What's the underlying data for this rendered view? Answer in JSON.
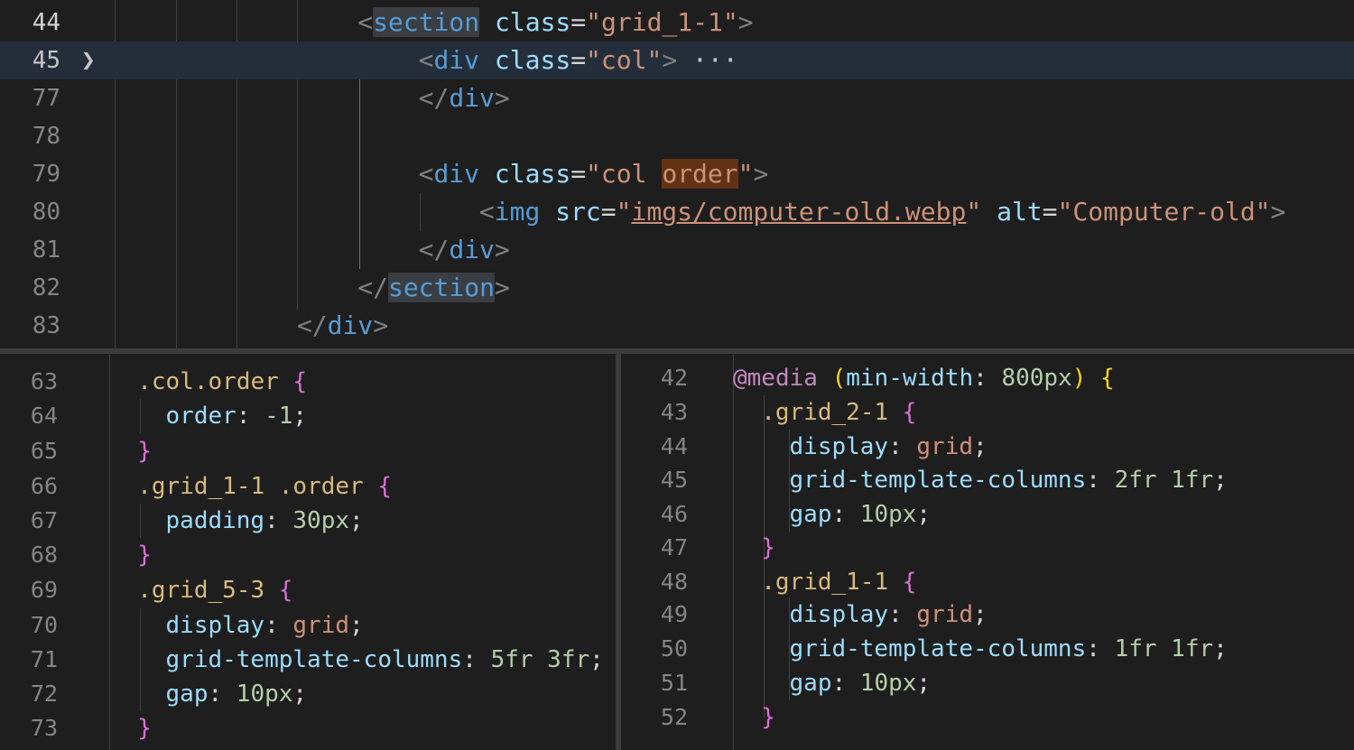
{
  "top_editor": {
    "lines": [
      {
        "n": "44",
        "parts": [
          {
            "t": "<",
            "c": "p"
          },
          {
            "t": "section",
            "c": "t sect"
          },
          {
            "t": " ",
            "c": "o"
          },
          {
            "t": "class",
            "c": "a"
          },
          {
            "t": "=",
            "c": "o"
          },
          {
            "t": "\"grid_1-1\"",
            "c": "s"
          },
          {
            "t": ">",
            "c": "p"
          }
        ]
      },
      {
        "n": "45",
        "parts": [
          {
            "t": "<",
            "c": "p"
          },
          {
            "t": "div",
            "c": "t"
          },
          {
            "t": " ",
            "c": "o"
          },
          {
            "t": "class",
            "c": "a"
          },
          {
            "t": "=",
            "c": "o"
          },
          {
            "t": "\"col\"",
            "c": "s"
          },
          {
            "t": ">",
            "c": "p"
          },
          {
            "t": " ···",
            "c": "ell"
          }
        ]
      },
      {
        "n": "77",
        "parts": [
          {
            "t": "</",
            "c": "p"
          },
          {
            "t": "div",
            "c": "t"
          },
          {
            "t": ">",
            "c": "p"
          }
        ]
      },
      {
        "n": "78",
        "parts": []
      },
      {
        "n": "79",
        "parts": [
          {
            "t": "<",
            "c": "p"
          },
          {
            "t": "div",
            "c": "t"
          },
          {
            "t": " ",
            "c": "o"
          },
          {
            "t": "class",
            "c": "a"
          },
          {
            "t": "=",
            "c": "o"
          },
          {
            "t": "\"col ",
            "c": "s"
          },
          {
            "t": "order",
            "c": "s hl"
          },
          {
            "t": "\"",
            "c": "s"
          },
          {
            "t": ">",
            "c": "p"
          }
        ]
      },
      {
        "n": "80",
        "parts": [
          {
            "t": "<",
            "c": "p"
          },
          {
            "t": "img",
            "c": "t"
          },
          {
            "t": " ",
            "c": "o"
          },
          {
            "t": "src",
            "c": "a"
          },
          {
            "t": "=",
            "c": "o"
          },
          {
            "t": "\"",
            "c": "s"
          },
          {
            "t": "imgs/computer-old.webp",
            "c": "s ul"
          },
          {
            "t": "\"",
            "c": "s"
          },
          {
            "t": " ",
            "c": "o"
          },
          {
            "t": "alt",
            "c": "a"
          },
          {
            "t": "=",
            "c": "o"
          },
          {
            "t": "\"Computer-old\"",
            "c": "s"
          },
          {
            "t": ">",
            "c": "p"
          }
        ]
      },
      {
        "n": "81",
        "parts": [
          {
            "t": "</",
            "c": "p"
          },
          {
            "t": "div",
            "c": "t"
          },
          {
            "t": ">",
            "c": "p"
          }
        ]
      },
      {
        "n": "82",
        "parts": [
          {
            "t": "</",
            "c": "p"
          },
          {
            "t": "section",
            "c": "t sect"
          },
          {
            "t": ">",
            "c": "p"
          }
        ]
      },
      {
        "n": "83",
        "parts": [
          {
            "t": "</",
            "c": "p"
          },
          {
            "t": "div",
            "c": "t"
          },
          {
            "t": ">",
            "c": "p"
          }
        ]
      }
    ]
  },
  "left_editor": {
    "lines": [
      {
        "n": "63",
        "parts": [
          {
            "t": ".col.order",
            "c": "sel"
          },
          {
            "t": " ",
            "c": "o"
          },
          {
            "t": "{",
            "c": "b1"
          }
        ]
      },
      {
        "n": "64",
        "parts": [
          {
            "t": "order",
            "c": "a"
          },
          {
            "t": ": ",
            "c": "o"
          },
          {
            "t": "-1",
            "c": "num2"
          },
          {
            "t": ";",
            "c": "o"
          }
        ]
      },
      {
        "n": "65",
        "parts": [
          {
            "t": "}",
            "c": "b1"
          }
        ]
      },
      {
        "n": "66",
        "parts": [
          {
            "t": ".grid_1-1 .order",
            "c": "sel"
          },
          {
            "t": " ",
            "c": "o"
          },
          {
            "t": "{",
            "c": "b1"
          }
        ]
      },
      {
        "n": "67",
        "parts": [
          {
            "t": "padding",
            "c": "a"
          },
          {
            "t": ": ",
            "c": "o"
          },
          {
            "t": "30px",
            "c": "num2"
          },
          {
            "t": ";",
            "c": "o"
          }
        ]
      },
      {
        "n": "68",
        "parts": [
          {
            "t": "}",
            "c": "b1"
          }
        ]
      },
      {
        "n": "69",
        "parts": [
          {
            "t": ".grid_5-3",
            "c": "sel"
          },
          {
            "t": " ",
            "c": "o"
          },
          {
            "t": "{",
            "c": "b1"
          }
        ]
      },
      {
        "n": "70",
        "parts": [
          {
            "t": "display",
            "c": "a"
          },
          {
            "t": ": ",
            "c": "o"
          },
          {
            "t": "grid",
            "c": "s"
          },
          {
            "t": ";",
            "c": "o"
          }
        ]
      },
      {
        "n": "71",
        "parts": [
          {
            "t": "grid-template-columns",
            "c": "a"
          },
          {
            "t": ": ",
            "c": "o"
          },
          {
            "t": "5fr 3fr",
            "c": "num2"
          },
          {
            "t": ";",
            "c": "o"
          }
        ]
      },
      {
        "n": "72",
        "parts": [
          {
            "t": "gap",
            "c": "a"
          },
          {
            "t": ": ",
            "c": "o"
          },
          {
            "t": "10px",
            "c": "num2"
          },
          {
            "t": ";",
            "c": "o"
          }
        ]
      },
      {
        "n": "73",
        "parts": [
          {
            "t": "}",
            "c": "b1"
          }
        ]
      }
    ]
  },
  "right_editor": {
    "lines": [
      {
        "n": "42",
        "parts": [
          {
            "t": "@media",
            "c": "kw"
          },
          {
            "t": " ",
            "c": "o"
          },
          {
            "t": "(",
            "c": "b2"
          },
          {
            "t": "min-width",
            "c": "a"
          },
          {
            "t": ": ",
            "c": "o"
          },
          {
            "t": "800px",
            "c": "num2"
          },
          {
            "t": ")",
            "c": "b2"
          },
          {
            "t": " ",
            "c": "o"
          },
          {
            "t": "{",
            "c": "b2"
          }
        ]
      },
      {
        "n": "43",
        "parts": [
          {
            "t": ".grid_2-1",
            "c": "sel"
          },
          {
            "t": " ",
            "c": "o"
          },
          {
            "t": "{",
            "c": "b1"
          }
        ]
      },
      {
        "n": "44",
        "parts": [
          {
            "t": "display",
            "c": "a"
          },
          {
            "t": ": ",
            "c": "o"
          },
          {
            "t": "grid",
            "c": "s"
          },
          {
            "t": ";",
            "c": "o"
          }
        ]
      },
      {
        "n": "45",
        "parts": [
          {
            "t": "grid-template-columns",
            "c": "a"
          },
          {
            "t": ": ",
            "c": "o"
          },
          {
            "t": "2fr 1fr",
            "c": "num2"
          },
          {
            "t": ";",
            "c": "o"
          }
        ]
      },
      {
        "n": "46",
        "parts": [
          {
            "t": "gap",
            "c": "a"
          },
          {
            "t": ": ",
            "c": "o"
          },
          {
            "t": "10px",
            "c": "num2"
          },
          {
            "t": ";",
            "c": "o"
          }
        ]
      },
      {
        "n": "47",
        "parts": [
          {
            "t": "}",
            "c": "b1"
          }
        ]
      },
      {
        "n": "48",
        "parts": [
          {
            "t": ".grid_1-1",
            "c": "sel"
          },
          {
            "t": " ",
            "c": "o"
          },
          {
            "t": "{",
            "c": "b1"
          }
        ]
      },
      {
        "n": "49",
        "parts": [
          {
            "t": "display",
            "c": "a"
          },
          {
            "t": ": ",
            "c": "o"
          },
          {
            "t": "grid",
            "c": "s"
          },
          {
            "t": ";",
            "c": "o"
          }
        ]
      },
      {
        "n": "50",
        "parts": [
          {
            "t": "grid-template-columns",
            "c": "a"
          },
          {
            "t": ": ",
            "c": "o"
          },
          {
            "t": "1fr 1fr",
            "c": "num2"
          },
          {
            "t": ";",
            "c": "o"
          }
        ]
      },
      {
        "n": "51",
        "parts": [
          {
            "t": "gap",
            "c": "a"
          },
          {
            "t": ": ",
            "c": "o"
          },
          {
            "t": "10px",
            "c": "num2"
          },
          {
            "t": ";",
            "c": "o"
          }
        ]
      },
      {
        "n": "52",
        "parts": [
          {
            "t": "}",
            "c": "b1"
          }
        ]
      }
    ]
  },
  "colors": {
    "background": "#1e1e1e",
    "tag": "#569cd6",
    "attribute": "#9cdcfe",
    "string": "#ce9178",
    "selector": "#d7ba7d",
    "number": "#b5cea8",
    "keyword": "#c586c0"
  },
  "icons": {
    "fold_collapsed": "chevron-right-icon"
  }
}
